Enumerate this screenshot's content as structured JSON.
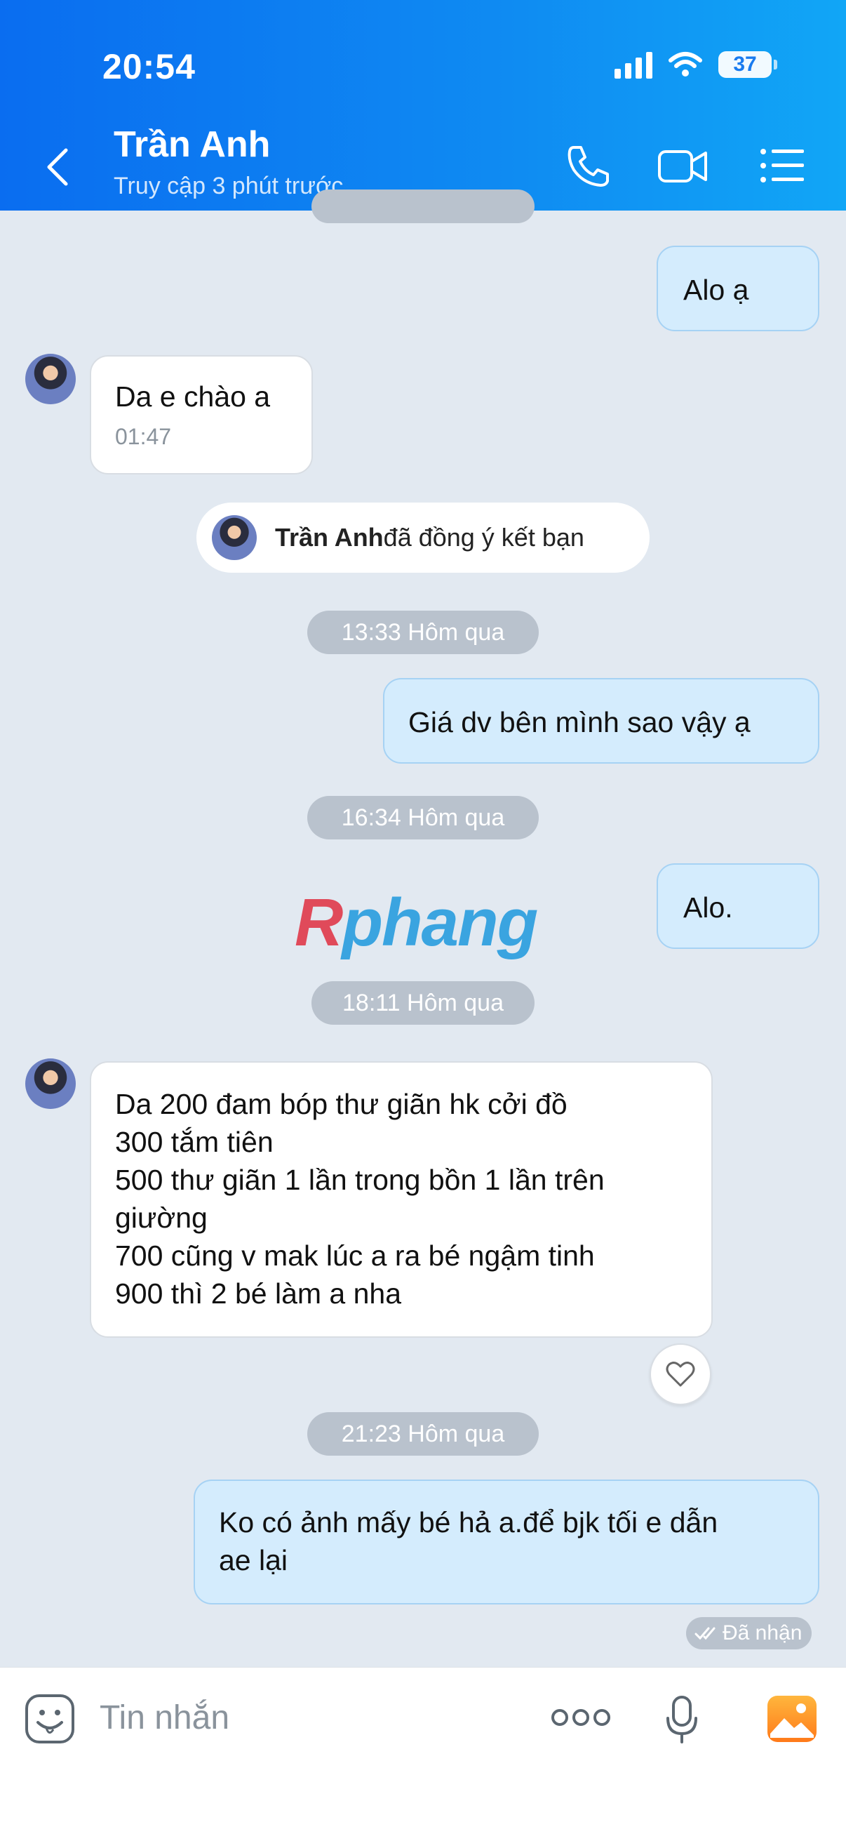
{
  "status_bar": {
    "time": "20:54",
    "battery": "37"
  },
  "header": {
    "contact_name": "Trần Anh",
    "last_seen": "Truy cập 3 phút trước"
  },
  "chat": {
    "messages": [
      {
        "text": "Alo ạ"
      },
      {
        "text": "Da e chào a",
        "time": "01:47"
      },
      {
        "name": "Trần Anh",
        "text": " đã đồng ý kết bạn"
      },
      {
        "text": "13:33 Hôm qua"
      },
      {
        "text": "Giá dv bên mình sao vậy ạ"
      },
      {
        "text": "16:34 Hôm qua"
      },
      {
        "text": "Alo."
      },
      {
        "text": "18:11 Hôm qua"
      },
      {
        "lines": [
          "Da 200 đam bóp thư giãn hk cởi đồ",
          "300 tắm tiên",
          "500 thư giãn 1 lần trong bồn 1 lần trên",
          "giường",
          "700 cũng v mak lúc a ra bé ngậm tinh",
          "900 thì 2 bé làm a nha"
        ]
      },
      {
        "text": "21:23 Hôm qua"
      },
      {
        "lines": [
          "Ko có ảnh mấy bé hả a.để bjk tối e dẫn",
          "ae lại"
        ]
      }
    ],
    "receipt": "Đã nhận",
    "watermark": "Rphang"
  },
  "composer": {
    "placeholder": "Tin nhắn"
  },
  "colors": {
    "header": "#0f8bf2",
    "mine_bubble": "#d4ecfd",
    "theirs_bubble": "#ffffff",
    "background": "#e2e9f1"
  },
  "icons": [
    "back-icon",
    "phone-icon",
    "video-icon",
    "menu-icon",
    "heart-icon",
    "sticker-icon",
    "more-icon",
    "mic-icon",
    "image-icon"
  ]
}
